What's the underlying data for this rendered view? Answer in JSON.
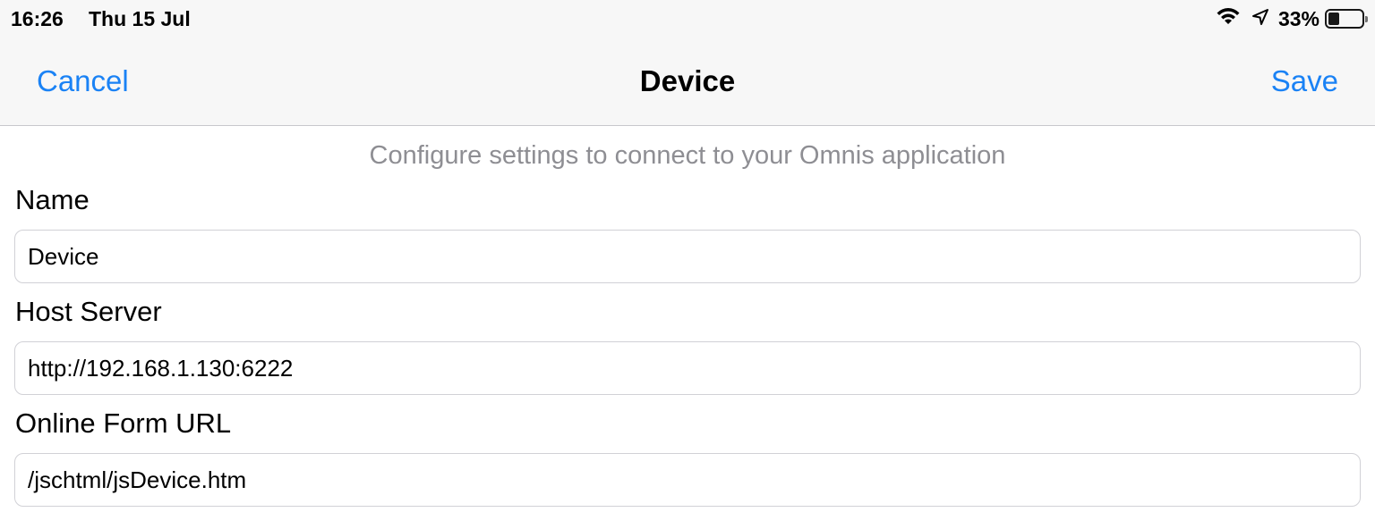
{
  "status_bar": {
    "time": "16:26",
    "date": "Thu 15 Jul",
    "battery_percent": "33%",
    "battery_level": 0.33,
    "icons": [
      "wifi-icon",
      "location-icon",
      "battery-icon"
    ]
  },
  "nav": {
    "cancel_label": "Cancel",
    "title": "Device",
    "save_label": "Save",
    "accent_color": "#1a82f5"
  },
  "form": {
    "hint": "Configure settings to connect to your Omnis application",
    "fields": [
      {
        "label": "Name",
        "value": "Device"
      },
      {
        "label": "Host Server",
        "value": "http://192.168.1.130:6222"
      },
      {
        "label": "Online Form URL",
        "value": "/jschtml/jsDevice.htm"
      }
    ]
  }
}
